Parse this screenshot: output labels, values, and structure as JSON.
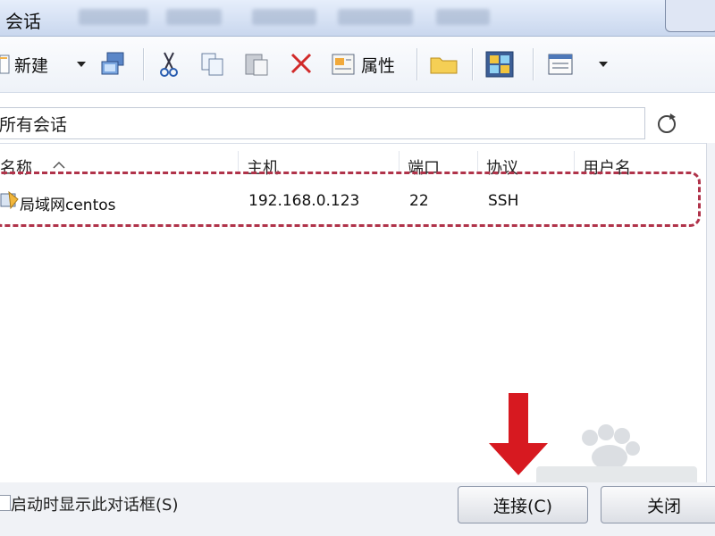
{
  "window": {
    "title": "会话"
  },
  "toolbar": {
    "new_label": "新建",
    "properties_label": "属性",
    "icons": [
      "new-session-icon",
      "dropdown-arrow-icon",
      "connect-icon",
      "cut-icon",
      "copy-icon",
      "paste-icon",
      "delete-icon",
      "properties-icon",
      "folder-icon",
      "app-icon",
      "view-icon",
      "dropdown-arrow-icon"
    ]
  },
  "path": {
    "text": "所有会话"
  },
  "table": {
    "headers": {
      "name": "名称",
      "host": "主机",
      "port": "端口",
      "protocol": "协议",
      "username": "用户名"
    },
    "rows": [
      {
        "name": "局域网centos",
        "host": "192.168.0.123",
        "port": "22",
        "protocol": "SSH",
        "username": ""
      }
    ]
  },
  "footer": {
    "startup_label": "启动时显示此对话框(S)",
    "startup_checked": false,
    "connect_label": "连接(C)",
    "close_label": "关闭"
  },
  "colors": {
    "highlight": "#b0334a",
    "arrow": "#d71920"
  }
}
